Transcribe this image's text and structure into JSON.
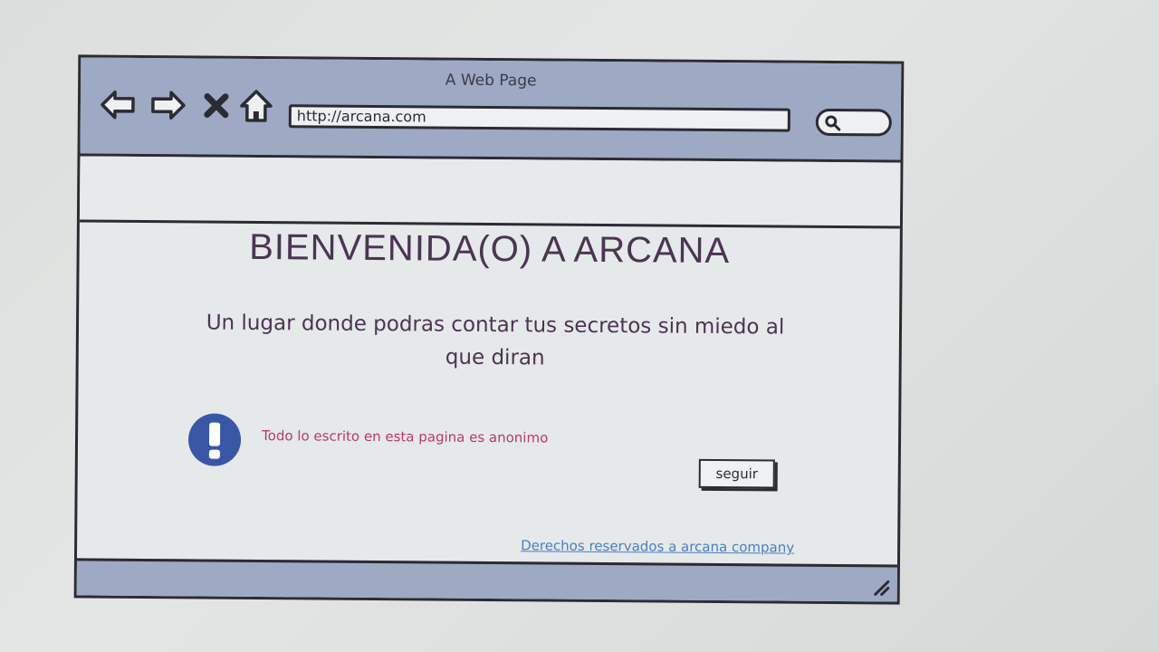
{
  "window": {
    "title": "A Web Page"
  },
  "browser": {
    "url": "http://arcana.com",
    "nav_icons": [
      "back-arrow-icon",
      "forward-arrow-icon",
      "close-icon",
      "home-icon"
    ],
    "search_icon": "search-icon"
  },
  "page": {
    "heading": "BIENVENIDA(O) A ARCANA",
    "subtitle": "Un lugar donde podras contar tus secretos sin miedo al que diran",
    "alert": {
      "icon": "exclamation-icon",
      "text": "Todo lo escrito en esta pagina es anonimo"
    },
    "continue_button": "seguir",
    "footer_link": "Derechos reservados a arcana company"
  },
  "colors": {
    "chrome": "#9ea9c4",
    "heading": "#4a3552",
    "alert_text": "#b83a66",
    "alert_icon": "#3a57a5",
    "link": "#4a7fc1"
  }
}
